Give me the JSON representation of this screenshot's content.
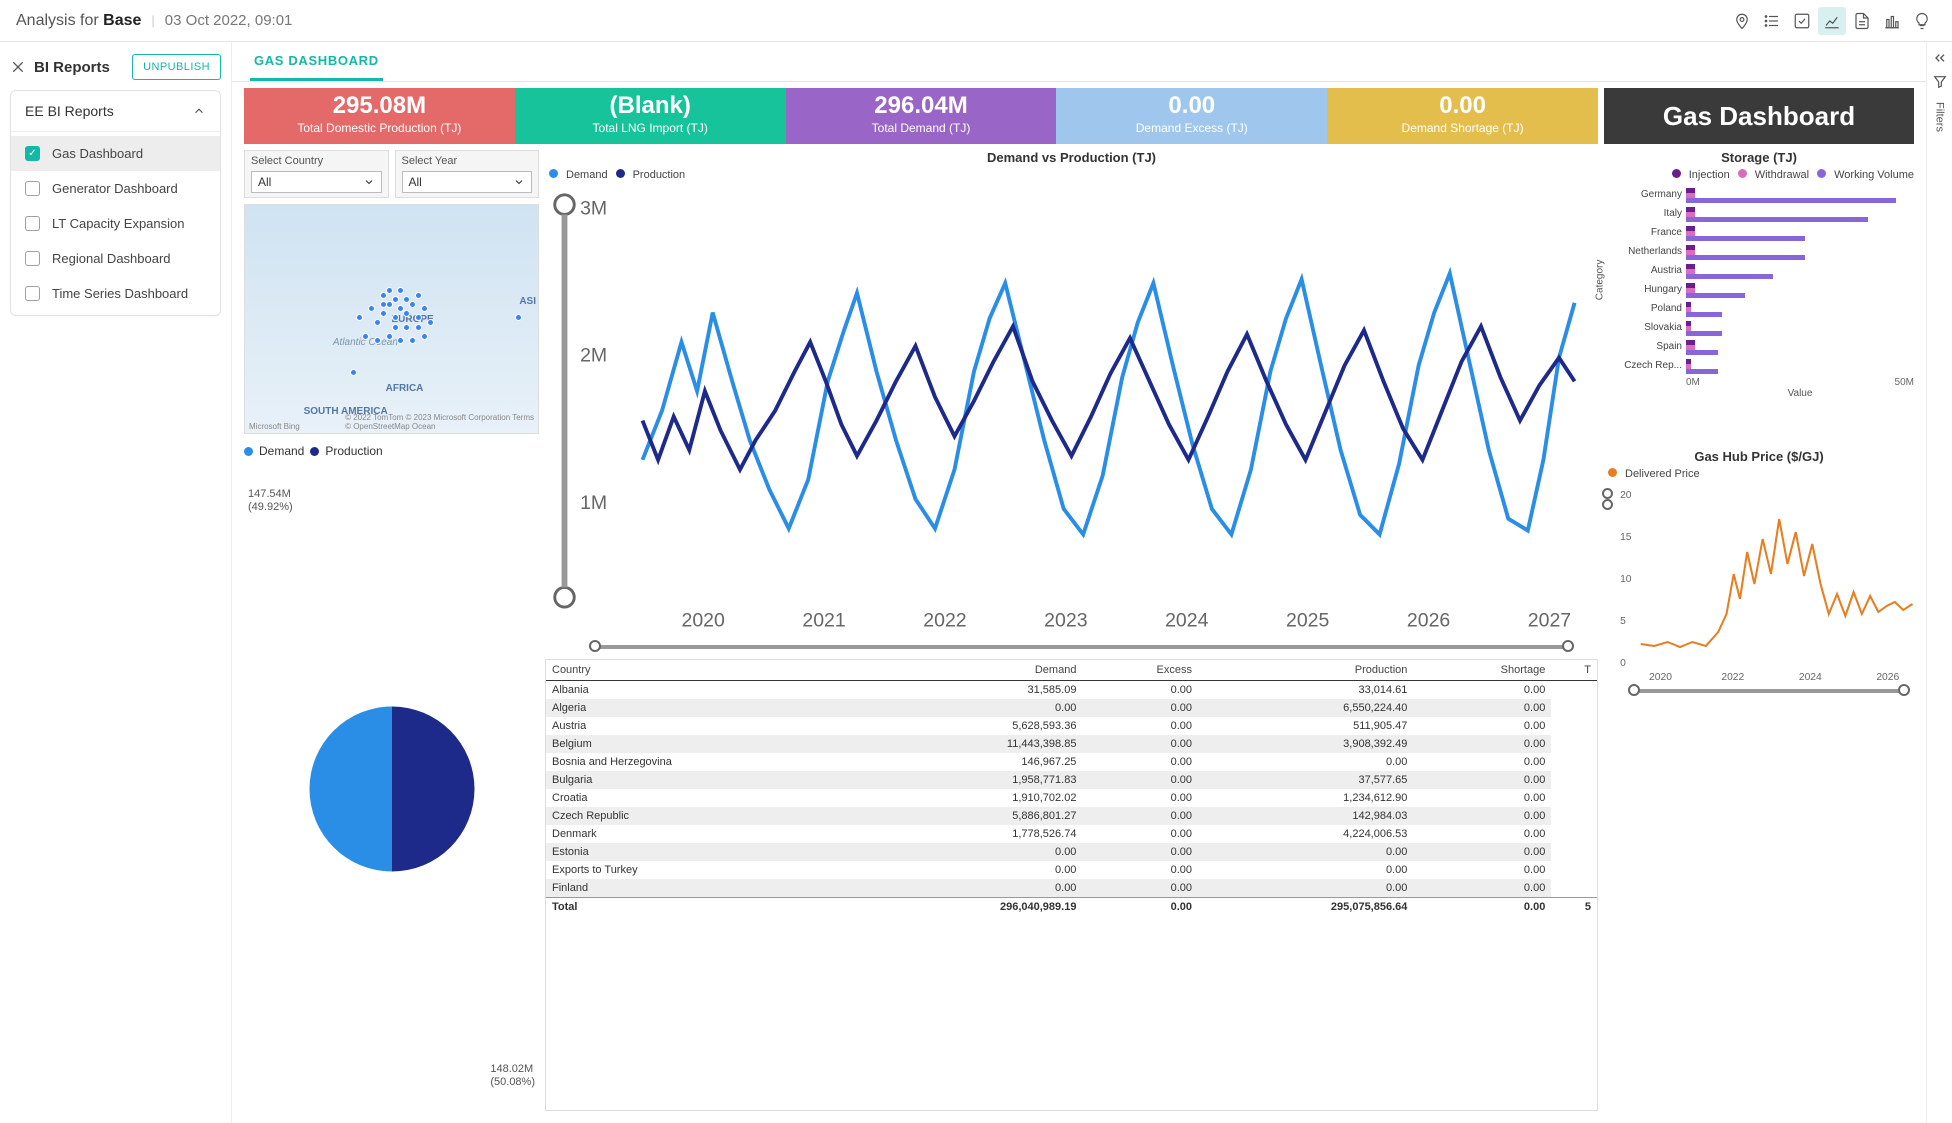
{
  "header": {
    "title_prefix": "Analysis for",
    "title_main": "Base",
    "date": "03 Oct 2022, 09:01"
  },
  "sidebar": {
    "title": "BI Reports",
    "unpublish": "UNPUBLISH",
    "card_title": "EE BI Reports",
    "items": [
      {
        "label": "Gas Dashboard",
        "checked": true
      },
      {
        "label": "Generator Dashboard",
        "checked": false
      },
      {
        "label": "LT Capacity Expansion",
        "checked": false
      },
      {
        "label": "Regional Dashboard",
        "checked": false
      },
      {
        "label": "Time Series Dashboard",
        "checked": false
      }
    ]
  },
  "tab": "GAS DASHBOARD",
  "kpi": [
    {
      "value": "295.08M",
      "label": "Total Domestic Production (TJ)"
    },
    {
      "value": "(Blank)",
      "label": "Total LNG Import (TJ)"
    },
    {
      "value": "296.04M",
      "label": "Total Demand (TJ)"
    },
    {
      "value": "0.00",
      "label": "Demand Excess (TJ)"
    },
    {
      "value": "0.00",
      "label": "Demand Shortage (TJ)"
    }
  ],
  "dash_title": "Gas Dashboard",
  "selectors": {
    "country": {
      "label": "Select Country",
      "value": "All"
    },
    "year": {
      "label": "Select Year",
      "value": "All"
    }
  },
  "map": {
    "labels": [
      "EUROPE",
      "AFRICA",
      "SOUTH AMERICA",
      "Atlantic Ocean",
      "ASI"
    ],
    "credit1": "Microsoft Bing",
    "credit2": "© 2022 TomTom © 2023 Microsoft Corporation  Terms",
    "credit3": "© OpenStreetMap  Ocean"
  },
  "pie": {
    "legend": [
      "Demand",
      "Production"
    ],
    "labels": [
      {
        "t1": "147.54M",
        "t2": "(49.92%)"
      },
      {
        "t1": "148.02M",
        "t2": "(50.08%)"
      }
    ]
  },
  "chart_data": [
    {
      "type": "line",
      "title": "Demand vs Production (TJ)",
      "x": [
        2020,
        2021,
        2022,
        2023,
        2024,
        2025,
        2026,
        2027
      ],
      "ylim": [
        0,
        3000000
      ],
      "yticks": [
        "1M",
        "2M",
        "3M"
      ],
      "series": [
        {
          "name": "Demand",
          "color": "#2b8ee6"
        },
        {
          "name": "Production",
          "color": "#1e2a8a"
        }
      ]
    },
    {
      "type": "bar",
      "title": "Storage (TJ)",
      "xlabel": "Value",
      "ylabel": "Category",
      "xlim": [
        0,
        50000000
      ],
      "xticks": [
        "0M",
        "50M"
      ],
      "categories": [
        "Germany",
        "Italy",
        "France",
        "Netherlands",
        "Austria",
        "Hungary",
        "Poland",
        "Slovakia",
        "Spain",
        "Czech Rep..."
      ],
      "series": [
        {
          "name": "Injection",
          "color": "#6b1e8e",
          "values": [
            2,
            2,
            2,
            2,
            2,
            2,
            1,
            1,
            2,
            1
          ]
        },
        {
          "name": "Withdrawal",
          "color": "#d96bc0",
          "values": [
            2,
            2,
            2,
            2,
            2,
            2,
            1,
            1,
            2,
            1
          ]
        },
        {
          "name": "Working Volume",
          "color": "#8866d9",
          "values": [
            46,
            40,
            26,
            26,
            19,
            13,
            8,
            8,
            7,
            7
          ]
        }
      ]
    },
    {
      "type": "line",
      "title": "Gas Hub Price ($/GJ)",
      "x": [
        2020,
        2022,
        2024,
        2026
      ],
      "yticks": [
        "0",
        "5",
        "10",
        "15",
        "20"
      ],
      "ylim": [
        0,
        20
      ],
      "series": [
        {
          "name": "Delivered Price",
          "color": "#e67e22"
        }
      ]
    },
    {
      "type": "pie",
      "series": [
        {
          "name": "Demand",
          "value": 148020000,
          "pct": 50.08,
          "color": "#2b8ee6"
        },
        {
          "name": "Production",
          "value": 147540000,
          "pct": 49.92,
          "color": "#1e2a8a"
        }
      ]
    }
  ],
  "table": {
    "columns": [
      "Country",
      "Demand",
      "Excess",
      "Production",
      "Shortage",
      "T"
    ],
    "rows": [
      [
        "Albania",
        "31,585.09",
        "0.00",
        "33,014.61",
        "0.00"
      ],
      [
        "Algeria",
        "0.00",
        "0.00",
        "6,550,224.40",
        "0.00"
      ],
      [
        "Austria",
        "5,628,593.36",
        "0.00",
        "511,905.47",
        "0.00"
      ],
      [
        "Belgium",
        "11,443,398.85",
        "0.00",
        "3,908,392.49",
        "0.00"
      ],
      [
        "Bosnia and Herzegovina",
        "146,967.25",
        "0.00",
        "0.00",
        "0.00"
      ],
      [
        "Bulgaria",
        "1,958,771.83",
        "0.00",
        "37,577.65",
        "0.00"
      ],
      [
        "Croatia",
        "1,910,702.02",
        "0.00",
        "1,234,612.90",
        "0.00"
      ],
      [
        "Czech Republic",
        "5,886,801.27",
        "0.00",
        "142,984.03",
        "0.00"
      ],
      [
        "Denmark",
        "1,778,526.74",
        "0.00",
        "4,224,006.53",
        "0.00"
      ],
      [
        "Estonia",
        "0.00",
        "0.00",
        "0.00",
        "0.00"
      ],
      [
        "Exports to Turkey",
        "0.00",
        "0.00",
        "0.00",
        "0.00"
      ],
      [
        "Finland",
        "0.00",
        "0.00",
        "0.00",
        "0.00"
      ]
    ],
    "total": [
      "Total",
      "296,040,989.19",
      "0.00",
      "295,075,856.64",
      "0.00",
      "5"
    ]
  },
  "filters_rail": "Filters"
}
